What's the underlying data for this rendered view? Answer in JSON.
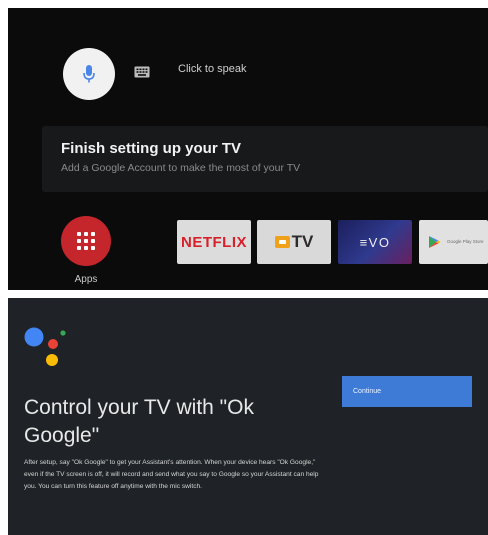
{
  "home": {
    "voice_search": {
      "mic_icon": "mic-icon",
      "keyboard_icon": "keyboard-icon",
      "prompt": "Click to speak"
    },
    "setup_card": {
      "title": "Finish setting up your TV",
      "subtitle": "Add a Google Account to make the most of your TV"
    },
    "apps": {
      "icon": "apps-grid-icon",
      "label": "Apps"
    },
    "app_tiles": [
      {
        "label": "NETFLIX",
        "brand_color": "#d8202a"
      },
      {
        "label": "TV",
        "icon": "tv-logo-icon",
        "brand_color": "#f0a11a"
      },
      {
        "label": "≡VO"
      },
      {
        "icon": "google-play-store-icon",
        "label": "Google Play Store"
      }
    ]
  },
  "assistant": {
    "icon": "google-assistant-dots-icon",
    "title": "Control your TV with \"Ok Google\"",
    "body": "After setup, say \"Ok Google\" to get your Assistant's attention. When your device hears \"Ok Google,\" even if the TV screen is off, it will record and send what you say to Google so your Assistant can help you. You can turn this feature off anytime with the mic switch.",
    "continue_label": "Continue",
    "accent_color": "#3d7bd6"
  }
}
